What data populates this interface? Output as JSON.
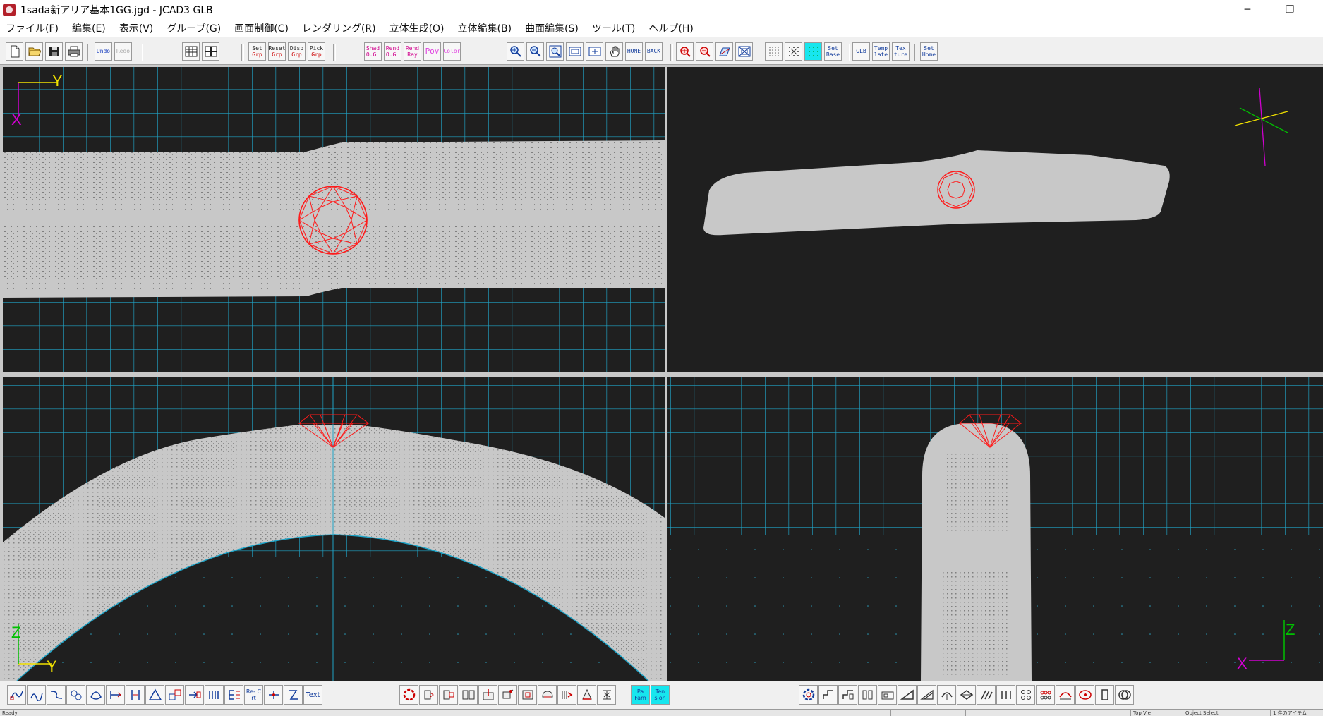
{
  "window": {
    "title": "1sada新アリア基本1GG.jgd - JCAD3 GLB",
    "minimize_glyph": "─",
    "restore_glyph": "❐"
  },
  "menu": [
    "ファイル(F)",
    "編集(E)",
    "表示(V)",
    "グループ(G)",
    "画面制御(C)",
    "レンダリング(R)",
    "立体生成(O)",
    "立体編集(B)",
    "曲面編集(S)",
    "ツール(T)",
    "ヘルプ(H)"
  ],
  "toolbar_top": {
    "file": [
      {
        "name": "new-file-icon",
        "label": ""
      },
      {
        "name": "open-folder-icon",
        "label": ""
      },
      {
        "name": "save-disk-icon",
        "label": ""
      },
      {
        "name": "print-icon",
        "label": ""
      }
    ],
    "undo": [
      "Undo",
      "Redo"
    ],
    "layout": [
      {
        "name": "single-view-icon",
        "label": ""
      },
      {
        "name": "quad-view-icon",
        "label": ""
      }
    ],
    "group": [
      [
        "Set",
        "Grp"
      ],
      [
        "Reset",
        "Grp"
      ],
      [
        "Disp",
        "Grp"
      ],
      [
        "Pick",
        "Grp"
      ]
    ],
    "render": [
      [
        "Shad",
        "O.GL"
      ],
      [
        "Rend",
        "O.GL"
      ],
      [
        "Rend",
        "Ray"
      ],
      [
        "Pov",
        ""
      ],
      [
        "Color",
        ""
      ]
    ],
    "view": [
      {
        "name": "zoom-in-icon",
        "label": ""
      },
      {
        "name": "zoom-out-icon",
        "label": ""
      },
      {
        "name": "zoom-window-icon",
        "label": ""
      },
      {
        "name": "zoom-all-icon",
        "label": ""
      },
      {
        "name": "zoom-fit-icon",
        "label": ""
      },
      {
        "name": "pan-hand-icon",
        "label": ""
      },
      {
        "name": "home-view-button",
        "label": "HOME"
      },
      {
        "name": "back-view-button",
        "label": "BACK"
      }
    ],
    "view2": [
      {
        "name": "zoom-in-red-icon",
        "label": ""
      },
      {
        "name": "zoom-out-red-icon",
        "label": ""
      },
      {
        "name": "perspective-icon",
        "label": ""
      },
      {
        "name": "frame-icon",
        "label": ""
      }
    ],
    "grid": [
      {
        "name": "grid-dots-icon",
        "label": ""
      },
      {
        "name": "grid-snap-icon",
        "label": ""
      },
      {
        "name": "grid-active-icon",
        "label": ""
      }
    ],
    "misc": [
      [
        "Set",
        "Base"
      ],
      [
        "GLB",
        ""
      ],
      [
        "Temp",
        "late"
      ],
      [
        "Tex",
        "ture"
      ],
      [
        "Set",
        "Home"
      ]
    ]
  },
  "viewports": {
    "top_left": {
      "axis_h": "Y",
      "axis_v": "X"
    },
    "top_right": {
      "axis_h": "",
      "axis_v": ""
    },
    "bottom_left": {
      "axis_h": "Y",
      "axis_v": "Z"
    },
    "bottom_right": {
      "axis_h": "X",
      "axis_v": "Z"
    }
  },
  "toolbar_bottom": {
    "left": [
      "curve-1-icon",
      "curve-2-icon",
      "curve-3-icon",
      "curve-4-icon",
      "curve-5-icon",
      "curve-6-icon",
      "curve-7-icon",
      "curve-8-icon",
      "curve-9-icon",
      "curve-10-icon",
      "curve-11-icon",
      "curve-12-icon",
      "curve-13-icon",
      "curve-14-icon",
      "curve-15-icon"
    ],
    "left_labels": [
      "Re- Crt",
      "Text"
    ],
    "middle": [
      "solid-1-icon",
      "solid-2-icon",
      "solid-3-icon",
      "solid-4-icon",
      "solid-5-icon",
      "solid-6-icon",
      "solid-7-icon",
      "solid-8-icon",
      "solid-9-icon",
      "solid-10-icon",
      "solid-11-icon"
    ],
    "middle_labels": [
      "Pa Fam",
      "Ten sion"
    ],
    "right": [
      "surf-1-icon",
      "surf-2-icon",
      "surf-3-icon",
      "surf-4-icon",
      "surf-5-icon",
      "surf-6-icon",
      "surf-7-icon",
      "surf-8-icon",
      "surf-9-icon",
      "surf-10-icon",
      "surf-11-icon",
      "surf-12-icon",
      "surf-13-icon",
      "surf-14-icon",
      "surf-15-icon",
      "surf-16-icon"
    ]
  },
  "status": {
    "left": "Ready",
    "f1": "",
    "f2": "",
    "f3": "Top Vie",
    "f4": "Object Select",
    "f5": "1 件のアイテム"
  }
}
